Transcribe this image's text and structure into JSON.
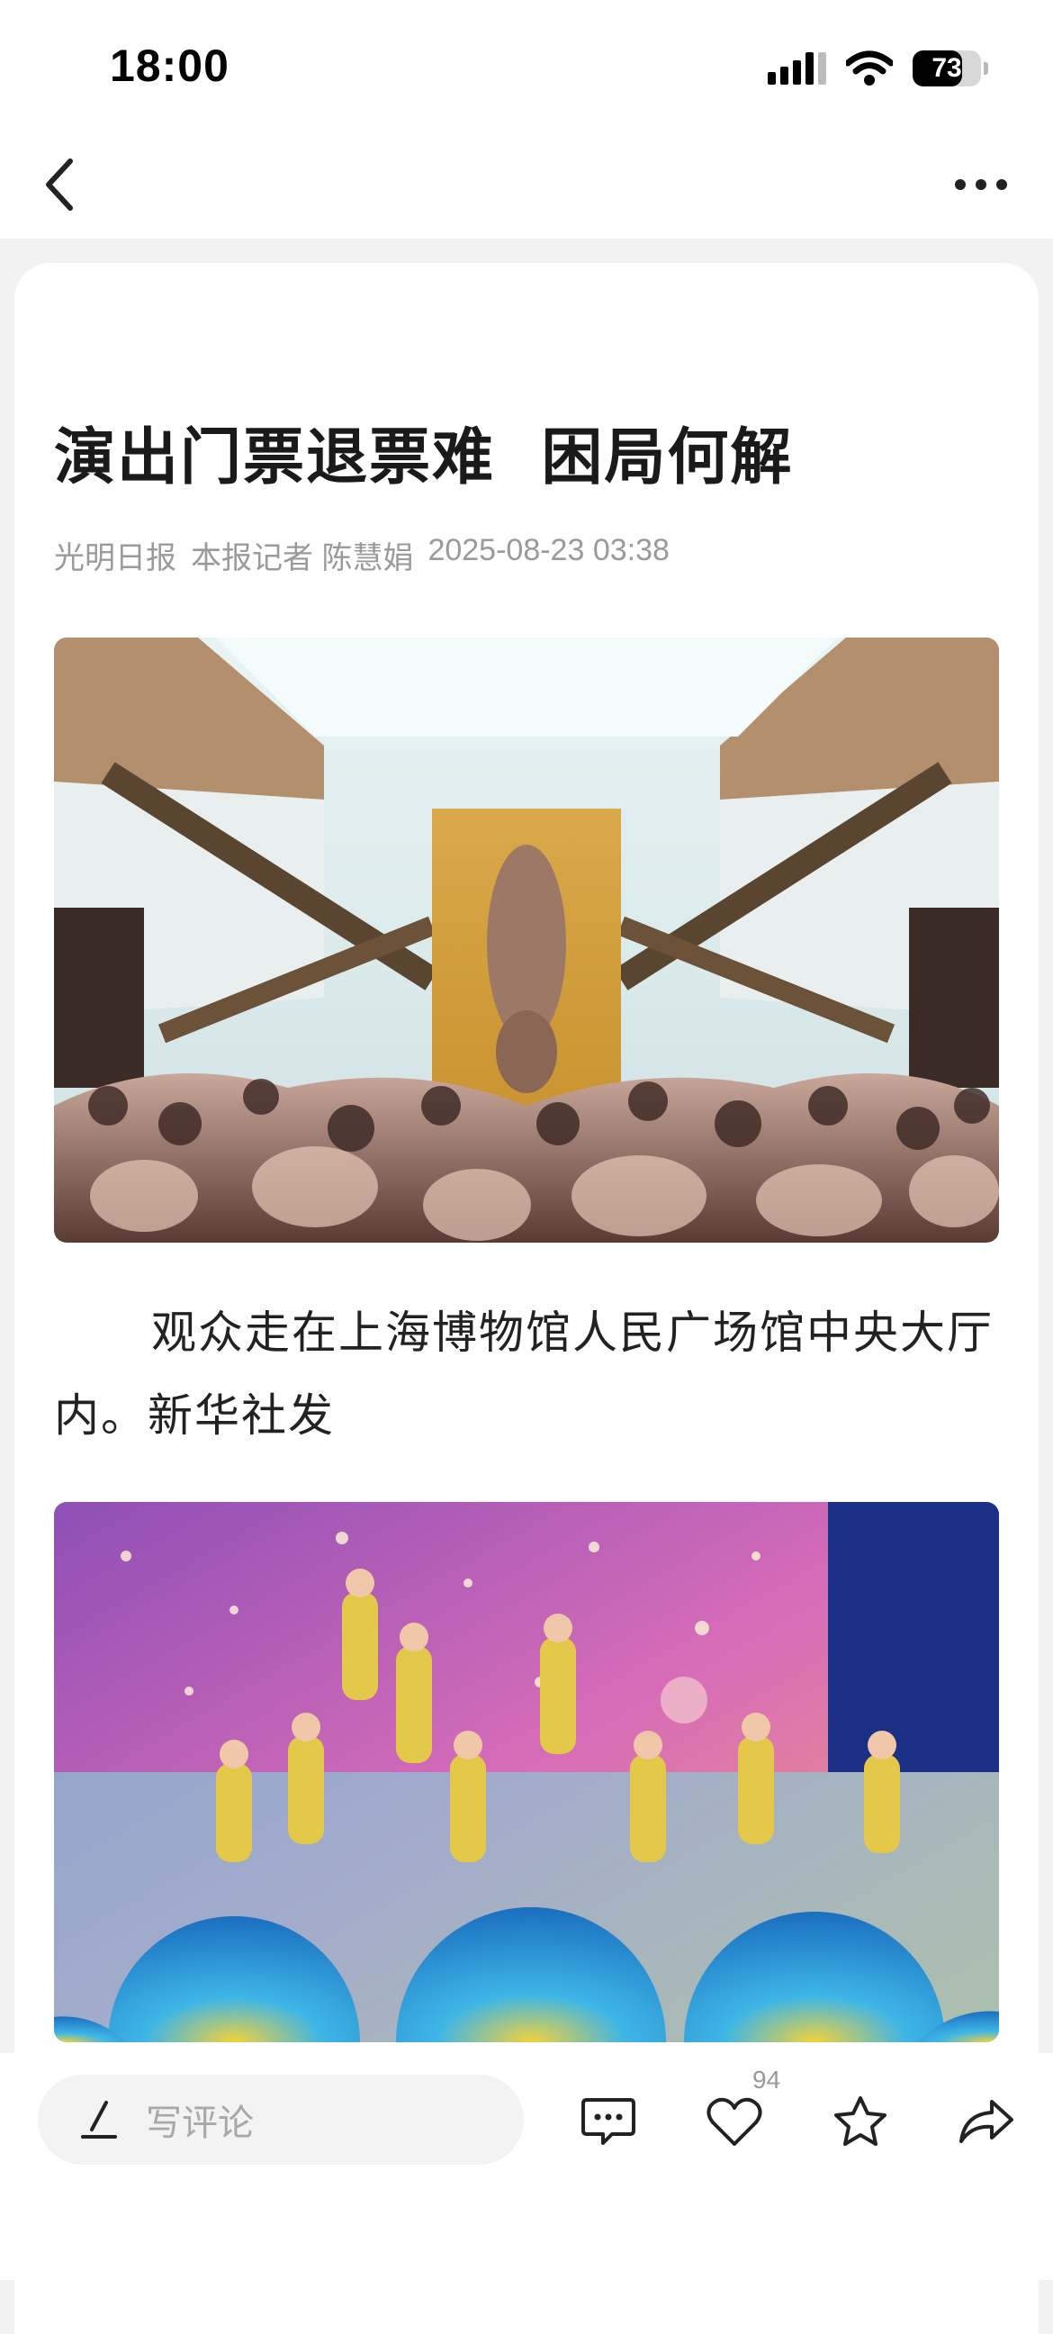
{
  "status": {
    "time": "18:00",
    "battery": "73",
    "battery_level": 0.73
  },
  "nav": {
    "back_label": "返回",
    "more_label": "更多"
  },
  "article": {
    "title": "演出门票退票难  困局何解",
    "source": "光明日报",
    "author": "本报记者 陈慧娟",
    "datetime": "2025-08-23 03:38",
    "caption": "观众走在上海博物馆人民广场馆中央大厅内。新华社发"
  },
  "bottom": {
    "comment_placeholder": "写评论",
    "like_count": "94"
  },
  "colors": {
    "title": "#1a1a1a",
    "meta": "#9a9a9a",
    "background": "#f2f2f2"
  },
  "icons": [
    "signal-icon",
    "wifi-icon",
    "battery-icon",
    "back-icon",
    "more-icon",
    "pen-icon",
    "comment-icon",
    "heart-icon",
    "star-icon",
    "share-icon"
  ]
}
